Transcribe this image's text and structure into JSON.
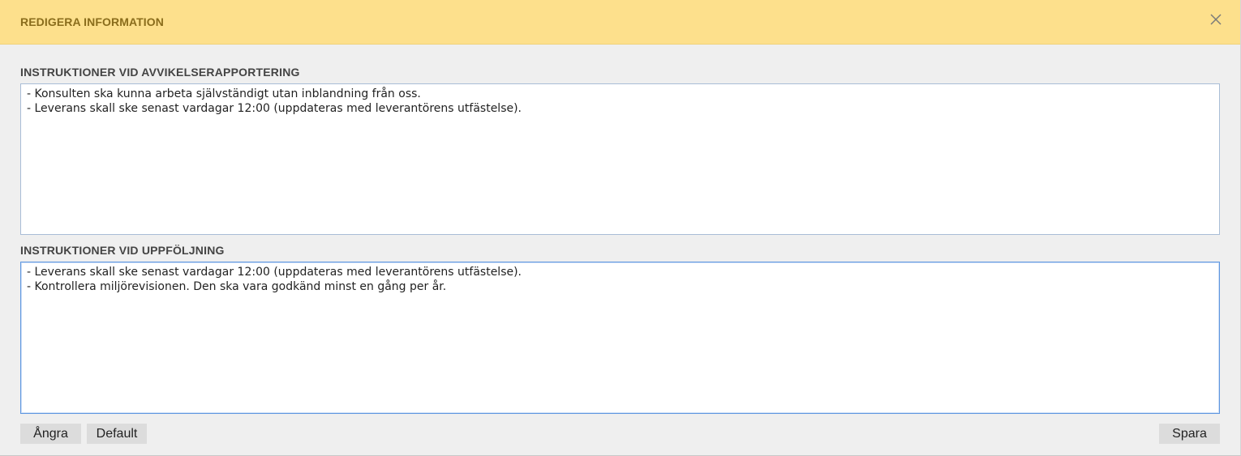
{
  "dialog": {
    "title": "REDIGERA INFORMATION",
    "close_icon": "close-icon"
  },
  "sections": [
    {
      "label": "INSTRUKTIONER VID AVVIKELSERAPPORTERING",
      "value": "- Konsulten ska kunna arbeta självständigt utan inblandning från oss.\n- Leverans skall ske senast vardagar 12:00 (uppdateras med leverantörens utfästelse)."
    },
    {
      "label": "INSTRUKTIONER VID UPPFÖLJNING",
      "value": "- Leverans skall ske senast vardagar 12:00 (uppdateras med leverantörens utfästelse).\n- Kontrollera miljörevisionen. Den ska vara godkänd minst en gång per år."
    }
  ],
  "buttons": {
    "undo": "Ångra",
    "default": "Default",
    "save": "Spara"
  },
  "colors": {
    "header_bg": "#fde08c",
    "header_text": "#8a6d1c",
    "panel_bg": "#efefef",
    "focus_border": "#5f97e0",
    "button_bg": "#dcdcdc"
  }
}
